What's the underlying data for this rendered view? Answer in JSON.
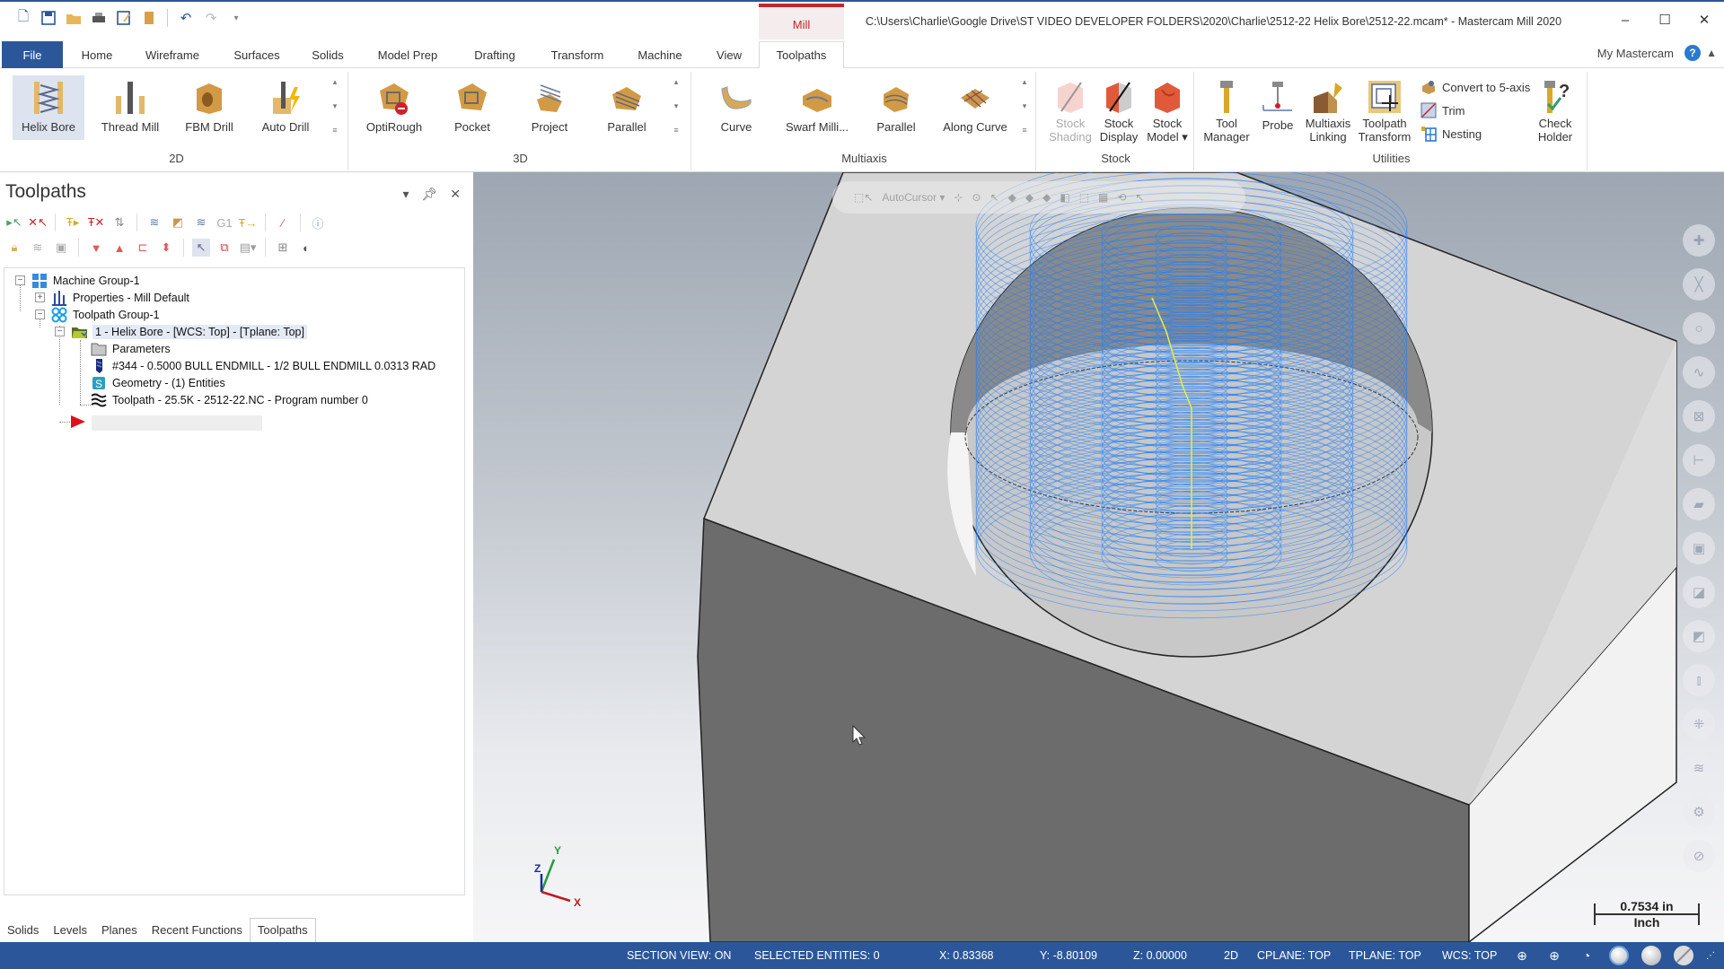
{
  "app": {
    "context_tab": "Mill",
    "window_title": "C:\\Users\\Charlie\\Google Drive\\ST VIDEO DEVELOPER FOLDERS\\2020\\Charlie\\2512-22 Helix Bore\\2512-22.mcam* - Mastercam Mill 2020",
    "window_controls": {
      "minimize": "–",
      "maximize": "☐",
      "close": "✕"
    }
  },
  "quick_access": [
    "new-icon",
    "save-icon",
    "open-icon",
    "print-icon",
    "save-as-icon",
    "merge-icon",
    "undo-icon",
    "redo-icon",
    "customize-icon"
  ],
  "tabs": [
    {
      "label": "File"
    },
    {
      "label": "Home"
    },
    {
      "label": "Wireframe"
    },
    {
      "label": "Surfaces"
    },
    {
      "label": "Solids"
    },
    {
      "label": "Model Prep"
    },
    {
      "label": "Drafting"
    },
    {
      "label": "Transform"
    },
    {
      "label": "Machine"
    },
    {
      "label": "View"
    },
    {
      "label": "Toolpaths",
      "active": true
    }
  ],
  "my_mastercam": "My Mastercam",
  "ribbon": {
    "groups": {
      "g2d": "2D",
      "g3d": "3D",
      "multiaxis": "Multiaxis",
      "stock": "Stock",
      "utilities": "Utilities"
    },
    "buttons_2d": [
      "Helix Bore",
      "Thread Mill",
      "FBM Drill",
      "Auto Drill"
    ],
    "buttons_3d": [
      "OptiRough",
      "Pocket",
      "Project",
      "Parallel"
    ],
    "buttons_multiaxis": [
      "Curve",
      "Swarf Milli...",
      "Parallel",
      "Along Curve"
    ],
    "stock": {
      "shading": [
        "Stock",
        "Shading"
      ],
      "display": [
        "Stock",
        "Display"
      ],
      "model": [
        "Stock",
        "Model ▾"
      ]
    },
    "utilities": {
      "tool_manager": [
        "Tool",
        "Manager"
      ],
      "probe": "Probe",
      "multiaxis_linking": [
        "Multiaxis",
        "Linking"
      ],
      "toolpath_transform": [
        "Toolpath",
        "Transform"
      ],
      "convert": "Convert to 5-axis",
      "trim": "Trim",
      "nesting": "Nesting",
      "check_holder": [
        "Check",
        "Holder"
      ]
    }
  },
  "toolpaths_panel": {
    "title": "Toolpaths",
    "tree": {
      "machine_group": "Machine Group-1",
      "properties": "Properties - Mill Default",
      "toolpath_group": "Toolpath Group-1",
      "operation": "1 - Helix Bore - [WCS: Top] - [Tplane: Top]",
      "parameters": "Parameters",
      "tool": "#344 - 0.5000 BULL ENDMILL - 1/2 BULL ENDMILL 0.0313 RAD",
      "geometry": "Geometry - (1) Entities",
      "toolpath": "Toolpath - 25.5K - 2512-22.NC - Program number 0"
    }
  },
  "bottom_tabs": [
    {
      "label": "Solids"
    },
    {
      "label": "Levels"
    },
    {
      "label": "Planes"
    },
    {
      "label": "Recent Functions"
    },
    {
      "label": "Toolpaths",
      "active": true
    }
  ],
  "viewport": {
    "autocursor": "AutoCursor ▾",
    "scale_value": "0.7534 in",
    "scale_unit": "Inch",
    "axes": {
      "x": "X",
      "y": "Y",
      "z": "Z"
    },
    "colors": {
      "toolpath": "#1e7fff",
      "entry": "#e8f03a",
      "stock_top": "#d4d4d4",
      "stock_side": "#6c6c6c"
    }
  },
  "status": {
    "section_view": "SECTION VIEW: ON",
    "selected": "SELECTED ENTITIES: 0",
    "x": "X:  0.83368",
    "y": "Y:  -8.80109",
    "z": "Z:  0.00000",
    "mode": "2D",
    "cplane": "CPLANE: TOP",
    "tplane": "TPLANE: TOP",
    "wcs": "WCS: TOP"
  }
}
